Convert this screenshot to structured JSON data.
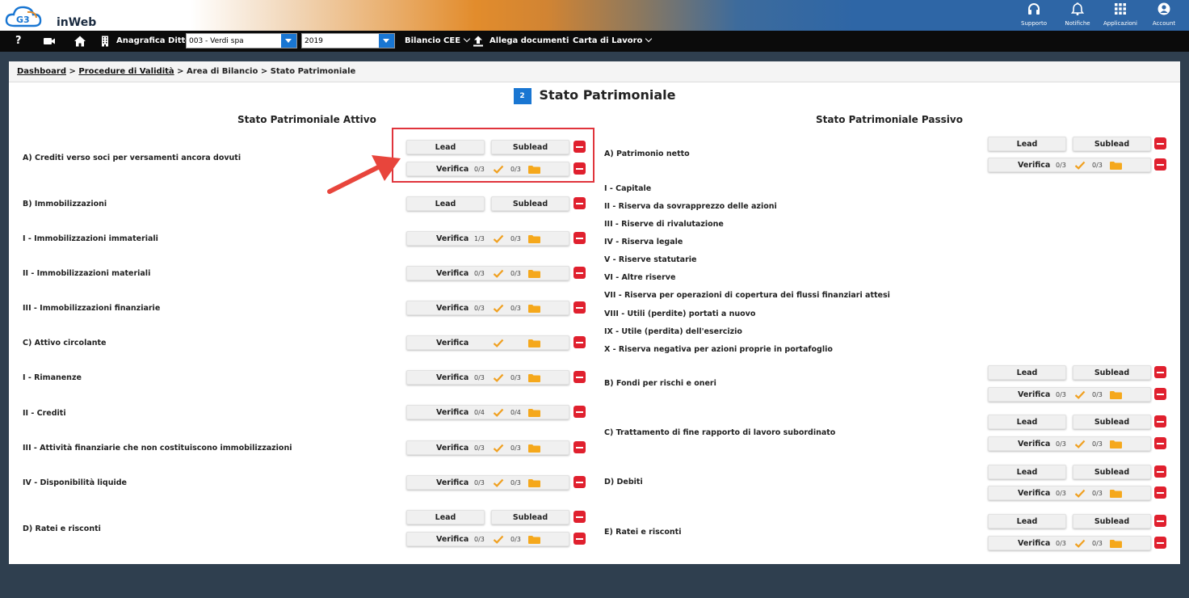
{
  "app": {
    "logo_text": "inWeb"
  },
  "top_actions": [
    {
      "label": "Supporto",
      "icon": "headset-icon"
    },
    {
      "label": "Notifiche",
      "icon": "bell-icon"
    },
    {
      "label": "Applicazioni",
      "icon": "grid-icon"
    },
    {
      "label": "Account",
      "icon": "account-icon"
    }
  ],
  "nav": {
    "help": "?",
    "company_label": "Anagrafica Ditte",
    "company_value": "003 - Verdi spa",
    "year_value": "2019",
    "bilancio": "Bilancio CEE",
    "allega": "Allega documenti",
    "carta": "Carta di Lavoro"
  },
  "breadcrumb": {
    "dashboard": "Dashboard",
    "sep": ">",
    "procedure": "Procedure di Validità",
    "area": "Area di Bilancio",
    "current": "Stato Patrimoniale"
  },
  "title": {
    "badge": "2",
    "text": "Stato Patrimoniale"
  },
  "buttons": {
    "lead": "Lead",
    "sublead": "Sublead",
    "verifica": "Verifica"
  },
  "attivo": {
    "heading": "Stato Patrimoniale Attivo",
    "rows": [
      {
        "label": "A) Crediti verso soci per versamenti ancora dovuti",
        "c1": "0/3",
        "c2": "0/3"
      },
      {
        "label": "B) Immobilizzazioni"
      },
      {
        "label": "I - Immobilizzazioni immateriali",
        "c1": "1/3",
        "c2": "0/3"
      },
      {
        "label": "II - Immobilizzazioni materiali",
        "c1": "0/3",
        "c2": "0/3"
      },
      {
        "label": "III - Immobilizzazioni finanziarie",
        "c1": "0/3",
        "c2": "0/3"
      },
      {
        "label": "C) Attivo circolante"
      },
      {
        "label": "I - Rimanenze",
        "c1": "0/3",
        "c2": "0/3"
      },
      {
        "label": "II - Crediti",
        "c1": "0/4",
        "c2": "0/4"
      },
      {
        "label": "III - Attività finanziarie che non costituiscono immobilizzazioni",
        "c1": "0/3",
        "c2": "0/3"
      },
      {
        "label": "IV - Disponibilità liquide",
        "c1": "0/3",
        "c2": "0/3"
      },
      {
        "label": "D) Ratei e risconti",
        "c1": "0/3",
        "c2": "0/3"
      }
    ]
  },
  "passivo": {
    "heading": "Stato Patrimoniale Passivo",
    "rows": [
      {
        "label": "A) Patrimonio netto",
        "c1": "0/3",
        "c2": "0/3"
      },
      {
        "label": "B) Fondi per rischi e oneri",
        "c1": "0/3",
        "c2": "0/3"
      },
      {
        "label": "C) Trattamento di fine rapporto di lavoro subordinato",
        "c1": "0/3",
        "c2": "0/3"
      },
      {
        "label": "D) Debiti",
        "c1": "0/3",
        "c2": "0/3"
      },
      {
        "label": "E) Ratei e risconti",
        "c1": "0/3",
        "c2": "0/3"
      }
    ],
    "riserve": [
      "I - Capitale",
      "II - Riserva da sovrapprezzo delle azioni",
      "III - Riserve di rivalutazione",
      "IV - Riserva legale",
      "V - Riserve statutarie",
      "VI - Altre riserve",
      "VII - Riserva per operazioni di copertura dei flussi finanziari attesi",
      "VIII - Utili (perdite) portati a nuovo",
      "IX - Utile (perdita) dell'esercizio",
      "X - Riserva negativa per azioni proprie in portafoglio"
    ]
  },
  "colors": {
    "accent": "#1976d2",
    "danger": "#e0202e",
    "check": "#f0a020",
    "folder": "#f5a81c"
  }
}
